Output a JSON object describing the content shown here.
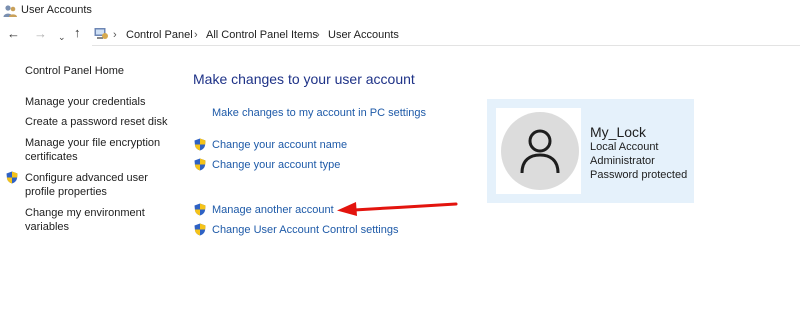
{
  "window": {
    "title": "User Accounts"
  },
  "nav": {
    "back_icon": "←",
    "forward_icon": "→",
    "recent_icon": "⌄",
    "up_icon": "↑",
    "address_icon": "control-panel-icon"
  },
  "breadcrumb": [
    "Control Panel",
    "All Control Panel Items",
    "User Accounts"
  ],
  "breadcrumb_separator": "›",
  "sidebar": {
    "home": "Control Panel Home",
    "items": [
      {
        "label": "Manage your credentials",
        "shield": false
      },
      {
        "label": "Create a password reset disk",
        "shield": false
      },
      {
        "label": "Manage your file encryption certificates",
        "shield": false
      },
      {
        "label": "Configure advanced user profile properties",
        "shield": true
      },
      {
        "label": "Change my environment variables",
        "shield": false
      }
    ]
  },
  "main": {
    "heading": "Make changes to your user account",
    "links": [
      {
        "label": "Make changes to my account in PC settings",
        "shield": false
      },
      {
        "label": "Change your account name",
        "shield": true
      },
      {
        "label": "Change your account type",
        "shield": true
      },
      {
        "label": "Manage another account",
        "shield": true
      },
      {
        "label": "Change User Account Control settings",
        "shield": true
      }
    ]
  },
  "account": {
    "name": "My_Lock",
    "type": "Local Account",
    "role": "Administrator",
    "password_status": "Password protected"
  },
  "colors": {
    "link": "#1e5aa8",
    "heading": "#1e3287",
    "card_bg": "#e5f1fb",
    "annotation": "#e3140e"
  }
}
